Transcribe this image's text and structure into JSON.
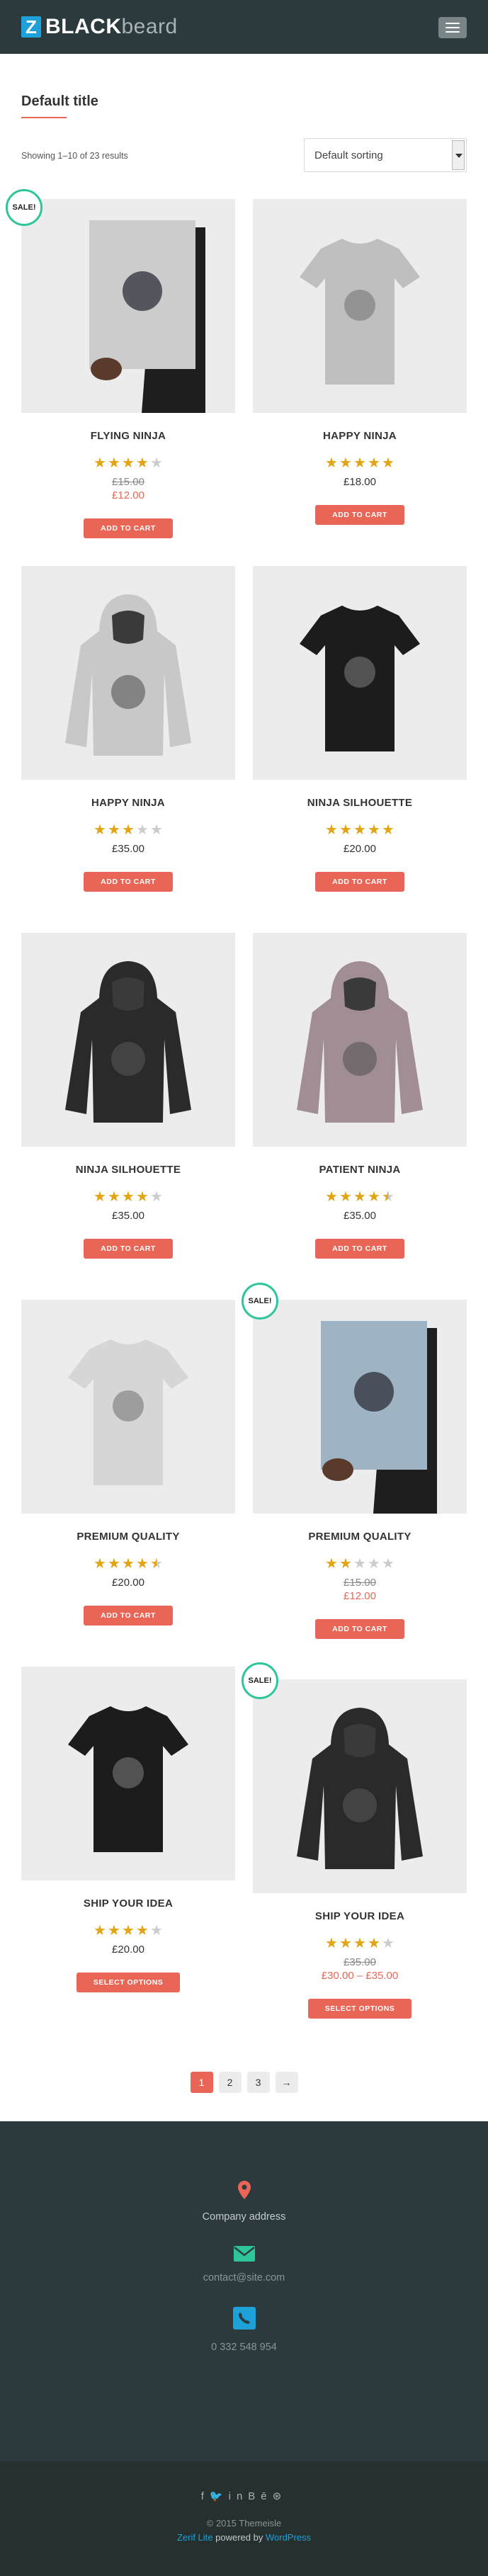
{
  "header": {
    "logo_letter": "Z",
    "logo_bold": "BLACK",
    "logo_light": "beard"
  },
  "page": {
    "title": "Default title",
    "result_count": "Showing 1–10 of 23 results",
    "orderby": "Default sorting"
  },
  "sale_label": "SALE!",
  "products": [
    {
      "name": "FLYING NINJA",
      "rating": 4,
      "old_price": "£15.00",
      "price": "£12.00",
      "button": "ADD TO CART",
      "sale": true
    },
    {
      "name": "HAPPY NINJA",
      "rating": 5,
      "price": "£18.00",
      "button": "ADD TO CART"
    },
    {
      "name": "HAPPY NINJA",
      "rating": 3,
      "price": "£35.00",
      "button": "ADD TO CART"
    },
    {
      "name": "NINJA SILHOUETTE",
      "rating": 5,
      "price": "£20.00",
      "button": "ADD TO CART"
    },
    {
      "name": "NINJA SILHOUETTE",
      "rating": 4,
      "price": "£35.00",
      "button": "ADD TO CART"
    },
    {
      "name": "PATIENT NINJA",
      "rating": 4.5,
      "price": "£35.00",
      "button": "ADD TO CART"
    },
    {
      "name": "PREMIUM QUALITY",
      "rating": 4.5,
      "price": "£20.00",
      "button": "ADD TO CART"
    },
    {
      "name": "PREMIUM QUALITY",
      "rating": 2,
      "old_price": "£15.00",
      "price": "£12.00",
      "button": "ADD TO CART",
      "sale": true
    },
    {
      "name": "SHIP YOUR IDEA",
      "rating": 4,
      "price": "£20.00",
      "button": "SELECT OPTIONS"
    },
    {
      "name": "SHIP YOUR IDEA",
      "rating": 4,
      "old_price": "£35.00",
      "price": "£30.00 – £35.00",
      "button": "SELECT OPTIONS",
      "sale": true
    }
  ],
  "pagination": {
    "pages": [
      "1",
      "2",
      "3"
    ],
    "next": "→",
    "current": "1"
  },
  "footer": {
    "address": "Company address",
    "email": "contact@site.com",
    "phone": "0 332 548 954",
    "social_icons": [
      "facebook-icon",
      "twitter-icon",
      "linkedin-icon",
      "behance-icon",
      "dribbble-icon"
    ],
    "copyright": "© 2015 Themeisle",
    "credit_theme": "Zerif Lite",
    "credit_mid": "powered by",
    "credit_wp": "WordPress"
  },
  "colors": {
    "accent": "#e96656",
    "sale_ring": "#2fc59b",
    "star": "#e3a412",
    "header": "#2c3a3d"
  }
}
